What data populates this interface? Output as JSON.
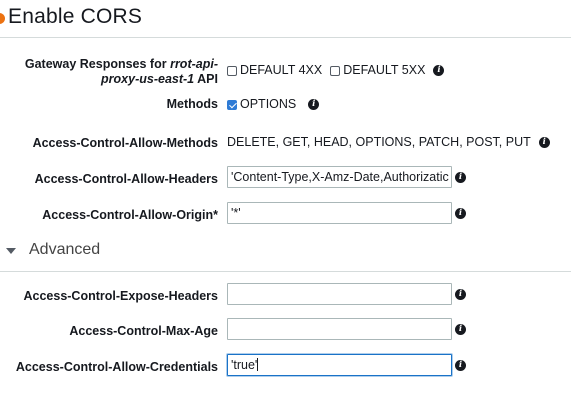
{
  "header": {
    "title": "Enable CORS"
  },
  "gateway": {
    "label_prefix": "Gateway Responses for ",
    "api_name": "rrot-api-proxy-us-east-1",
    "label_suffix": " API",
    "options": [
      {
        "label": "DEFAULT 4XX",
        "checked": false
      },
      {
        "label": "DEFAULT 5XX",
        "checked": false
      }
    ]
  },
  "methods": {
    "label": "Methods",
    "option": {
      "label": "OPTIONS",
      "checked": true
    }
  },
  "allow_methods": {
    "label": "Access-Control-Allow-Methods",
    "value": "DELETE, GET, HEAD, OPTIONS, PATCH, POST, PUT"
  },
  "allow_headers": {
    "label": "Access-Control-Allow-Headers",
    "value": "'Content-Type,X-Amz-Date,Authorizatic"
  },
  "allow_origin": {
    "label": "Access-Control-Allow-Origin*",
    "value": "'*'"
  },
  "advanced": {
    "label": "Advanced",
    "expanded": true
  },
  "expose_headers": {
    "label": "Access-Control-Expose-Headers",
    "value": ""
  },
  "max_age": {
    "label": "Access-Control-Max-Age",
    "value": ""
  },
  "allow_credentials": {
    "label": "Access-Control-Allow-Credentials",
    "value": "'true'",
    "focused": true
  },
  "icons": {
    "info": "info-circle-icon",
    "expand": "triangle-down-icon",
    "info_glyph": "i"
  },
  "colors": {
    "accent": "#ec7211",
    "checkbox_checked": "#2f7bd5",
    "focus_border": "#1a73c8",
    "input_border": "#aab7b8"
  }
}
